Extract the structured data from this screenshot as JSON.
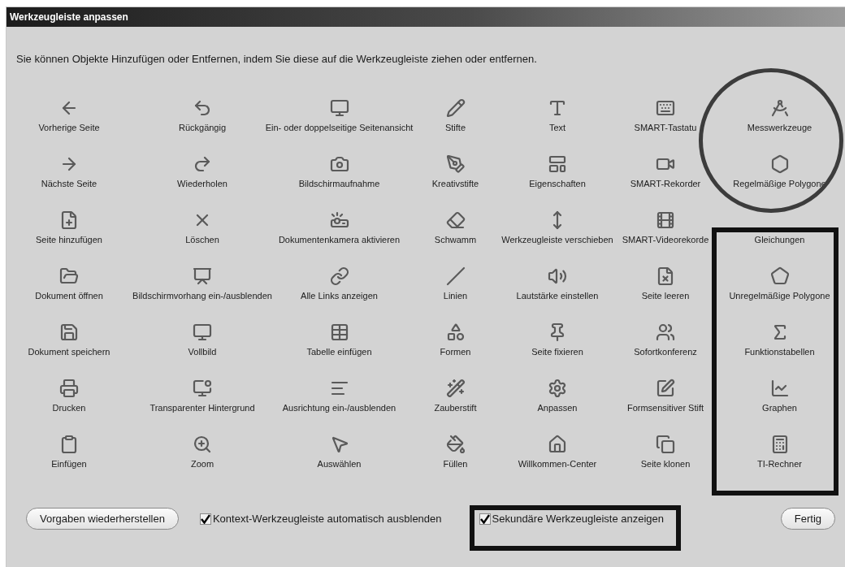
{
  "window": {
    "title": "Werkzeugleiste anpassen"
  },
  "instruction": "Sie können Objekte Hinzufügen oder Entfernen, indem Sie diese auf die Werkzeugleiste ziehen oder entfernen.",
  "tools": [
    {
      "label": "Vorherige Seite"
    },
    {
      "label": "Rückgängig"
    },
    {
      "label": "Ein- oder doppelseitige Seitenansicht"
    },
    {
      "label": "Stifte"
    },
    {
      "label": "Text"
    },
    {
      "label": "SMART-Tastatu"
    },
    {
      "label": "Messwerkzeuge"
    },
    {
      "label": "Nächste Seite"
    },
    {
      "label": "Wiederholen"
    },
    {
      "label": "Bildschirmaufnahme"
    },
    {
      "label": "Kreativstifte"
    },
    {
      "label": "Eigenschaften"
    },
    {
      "label": "SMART-Rekorder"
    },
    {
      "label": "Regelmäßige Polygone"
    },
    {
      "label": "Seite hinzufügen"
    },
    {
      "label": "Löschen"
    },
    {
      "label": "Dokumentenkamera aktivieren"
    },
    {
      "label": "Schwamm"
    },
    {
      "label": "Werkzeugleiste verschieben"
    },
    {
      "label": "SMART-Videorekorde"
    },
    {
      "label": "Gleichungen"
    },
    {
      "label": "Dokument öffnen"
    },
    {
      "label": "Bildschirmvorhang ein-/ausblenden"
    },
    {
      "label": "Alle Links anzeigen"
    },
    {
      "label": "Linien"
    },
    {
      "label": "Lautstärke einstellen"
    },
    {
      "label": "Seite leeren"
    },
    {
      "label": "Unregelmäßige Polygone"
    },
    {
      "label": "Dokument speichern"
    },
    {
      "label": "Vollbild"
    },
    {
      "label": "Tabelle einfügen"
    },
    {
      "label": "Formen"
    },
    {
      "label": "Seite fixieren"
    },
    {
      "label": "Sofortkonferenz"
    },
    {
      "label": "Funktionstabellen"
    },
    {
      "label": "Drucken"
    },
    {
      "label": "Transparenter Hintergrund"
    },
    {
      "label": "Ausrichtung ein-/ausblenden"
    },
    {
      "label": "Zauberstift"
    },
    {
      "label": "Anpassen"
    },
    {
      "label": "Formsensitiver Stift"
    },
    {
      "label": "Graphen"
    },
    {
      "label": "Einfügen"
    },
    {
      "label": "Zoom"
    },
    {
      "label": "Auswählen"
    },
    {
      "label": "Füllen"
    },
    {
      "label": "Willkommen-Center"
    },
    {
      "label": "Seite klonen"
    },
    {
      "label": "TI-Rechner"
    }
  ],
  "restore_button": {
    "label": "Vorgaben wiederherstellen"
  },
  "options": [
    {
      "label": "Kontext-Werkzeugleiste automatisch ausblenden",
      "checked": true
    },
    {
      "label": "Sekundäre Werkzeugleiste anzeigen",
      "checked": true
    }
  ],
  "done_button": {
    "label": "Fertig"
  },
  "annotations": [
    {
      "kind": "ellipse"
    },
    {
      "kind": "box"
    },
    {
      "kind": "box"
    }
  ]
}
